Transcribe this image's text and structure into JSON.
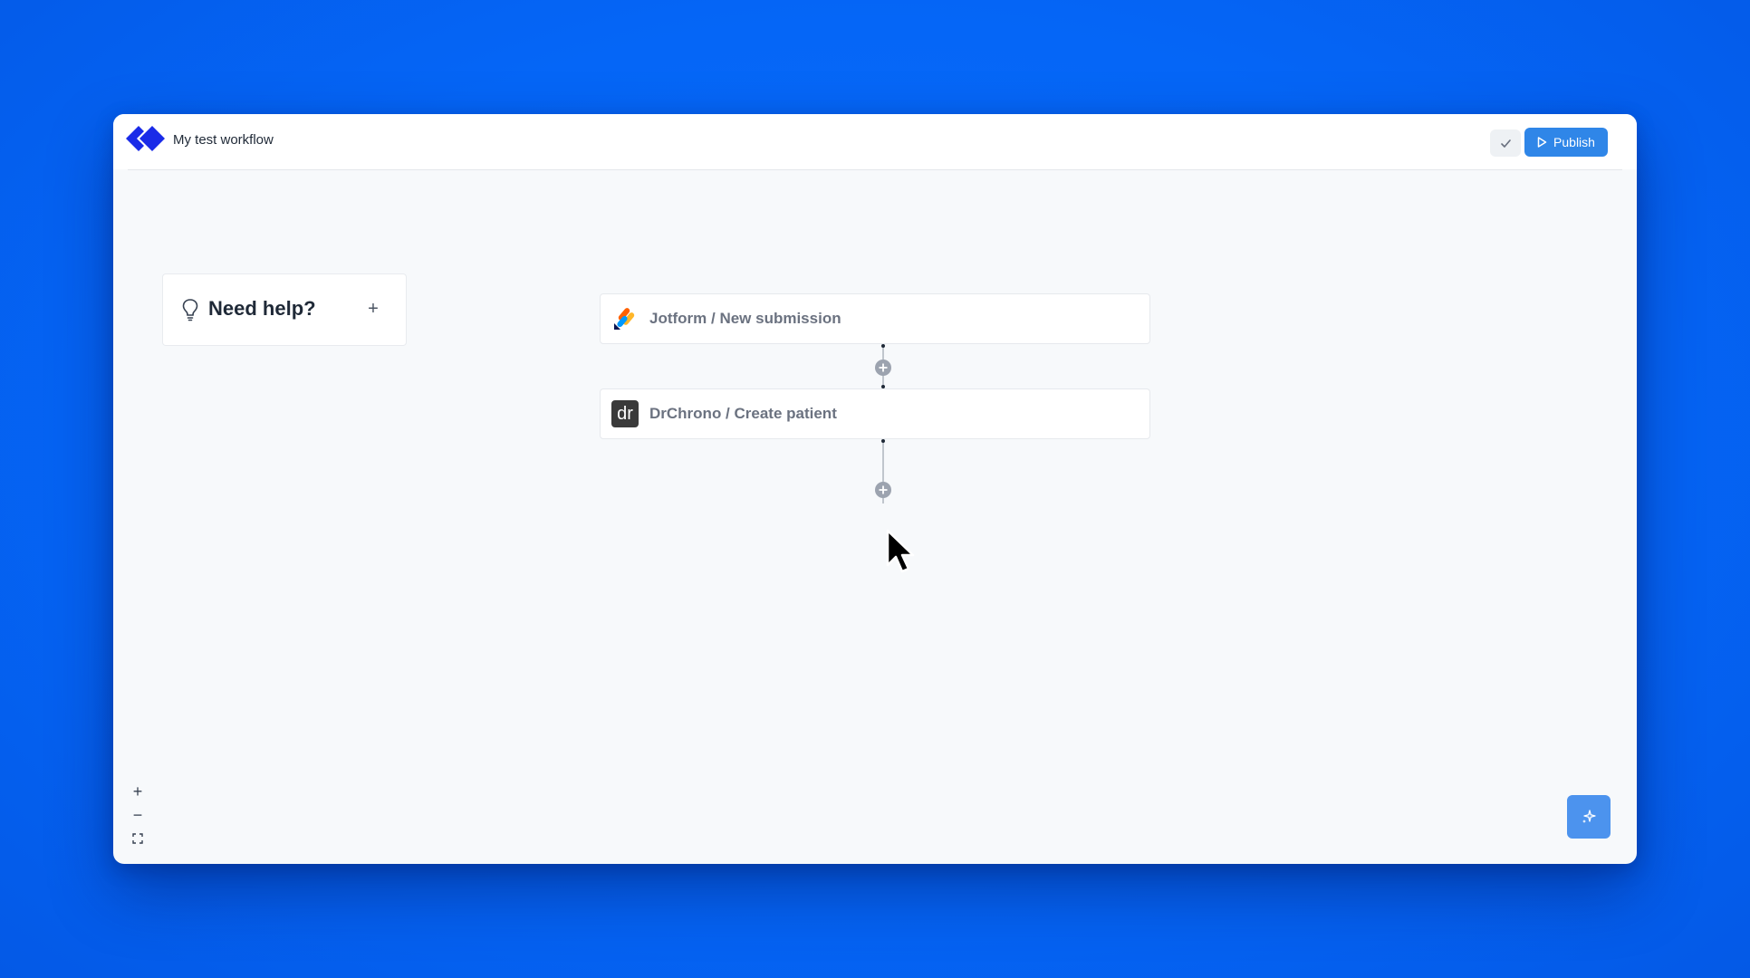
{
  "header": {
    "title": "My test workflow",
    "publish_label": "Publish"
  },
  "help_card": {
    "title": "Need help?",
    "add_symbol": "+"
  },
  "workflow": {
    "steps": [
      {
        "label": "Jotform / New submission",
        "icon": "jotform-icon"
      },
      {
        "label": "DrChrono / Create patient",
        "icon": "drchrono-icon",
        "icon_text": "dr"
      }
    ]
  },
  "zoom_controls": {
    "zoom_in": "+",
    "zoom_out": "−"
  },
  "colors": {
    "background": "#0566f7",
    "accent": "#2f86e8",
    "logo": "#1a2be8"
  }
}
